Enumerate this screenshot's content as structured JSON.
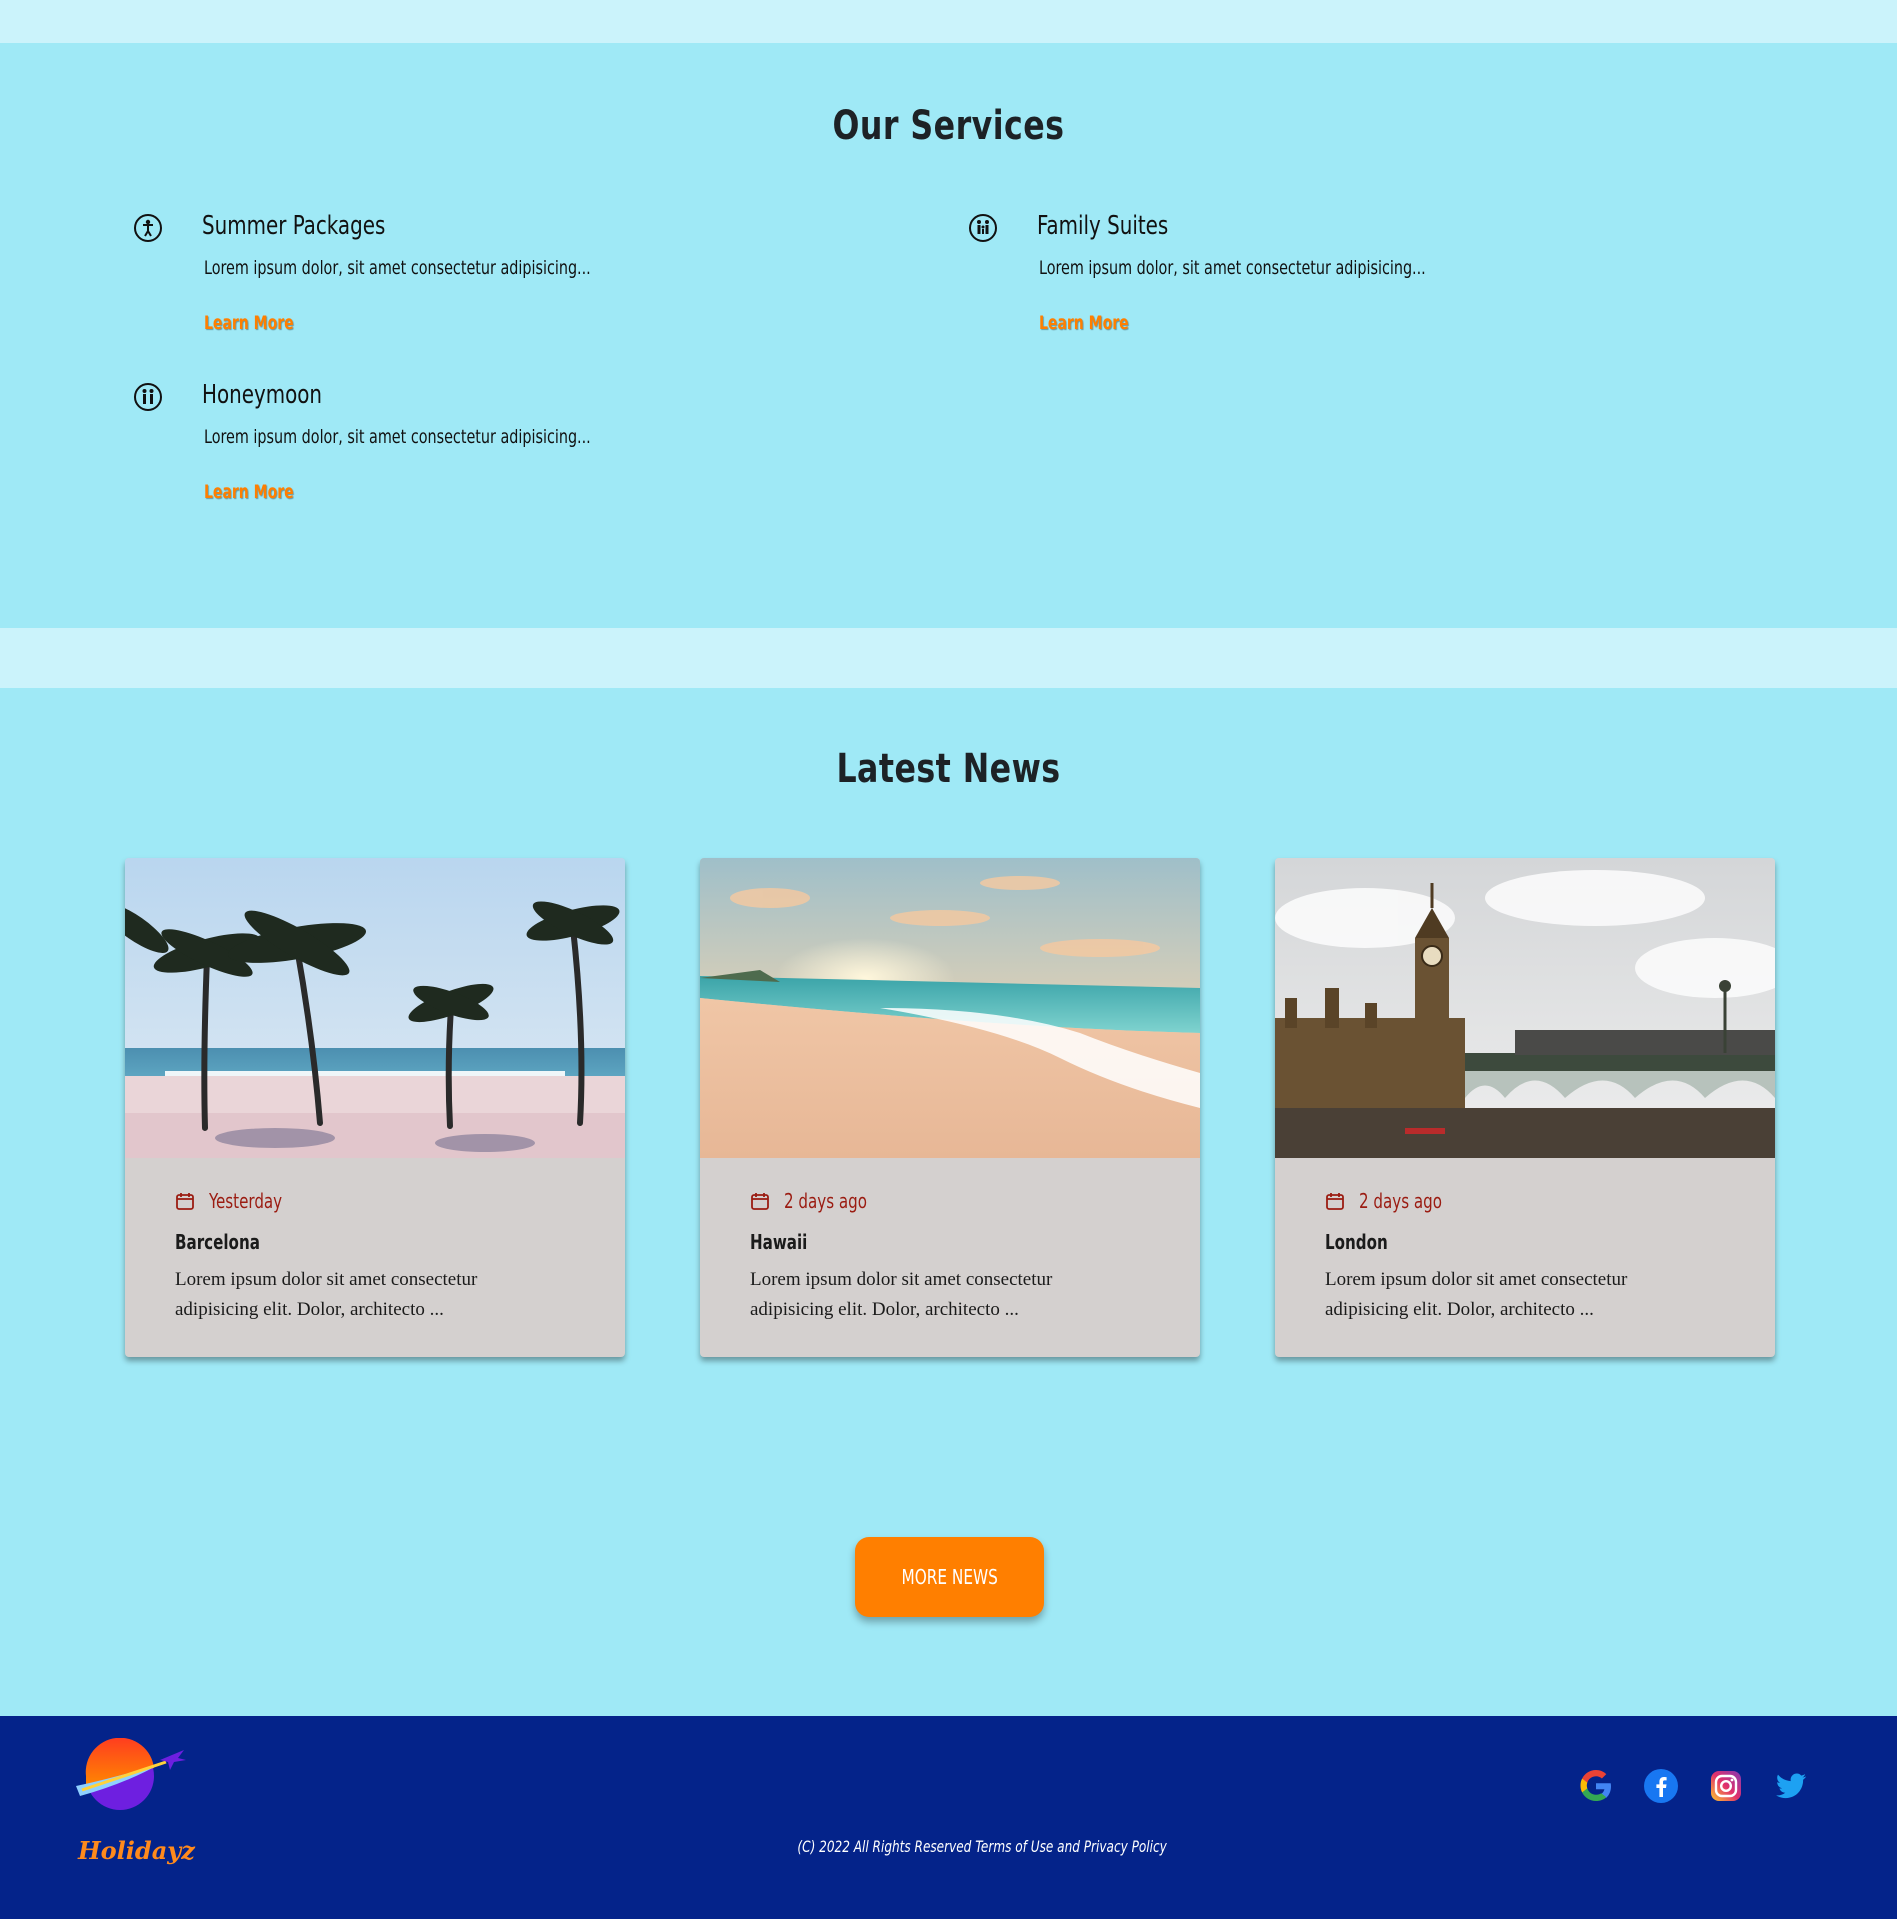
{
  "services": {
    "title": "Our Services",
    "items": [
      {
        "title": "Summer Packages",
        "desc": "Lorem ipsum dolor, sit amet consectetur adipisicing...",
        "link": "Learn More",
        "icon": "person-icon"
      },
      {
        "title": "Family Suites",
        "desc": "Lorem ipsum dolor, sit amet consectetur adipisicing...",
        "link": "Learn More",
        "icon": "family-icon"
      },
      {
        "title": "Honeymoon",
        "desc": "Lorem ipsum dolor, sit amet consectetur adipisicing...",
        "link": "Learn More",
        "icon": "couple-icon"
      }
    ]
  },
  "news": {
    "title": "Latest News",
    "cards": [
      {
        "date": "Yesterday",
        "title": "Barcelona",
        "text": "Lorem ipsum dolor sit amet consectetur adipisicing elit. Dolor, architecto ..."
      },
      {
        "date": "2 days ago",
        "title": "Hawaii",
        "text": "Lorem ipsum dolor sit amet consectetur adipisicing elit. Dolor, architecto ..."
      },
      {
        "date": "2 days ago",
        "title": "London",
        "text": "Lorem ipsum dolor sit amet consectetur adipisicing elit. Dolor, architecto ..."
      }
    ],
    "more_button": "MORE NEWS"
  },
  "footer": {
    "brand": "Holidayz",
    "copyright": "(C) 2022 All Rights Reserved Terms of Use and Privacy Policy",
    "social": [
      "google-icon",
      "facebook-icon",
      "instagram-icon",
      "twitter-icon"
    ]
  },
  "colors": {
    "background": "#9fe9f6",
    "band": "#cbf3fb",
    "accent": "#ff7f00",
    "footer": "#04238a",
    "card": "#d4d0cf",
    "date": "#9b1c12"
  }
}
